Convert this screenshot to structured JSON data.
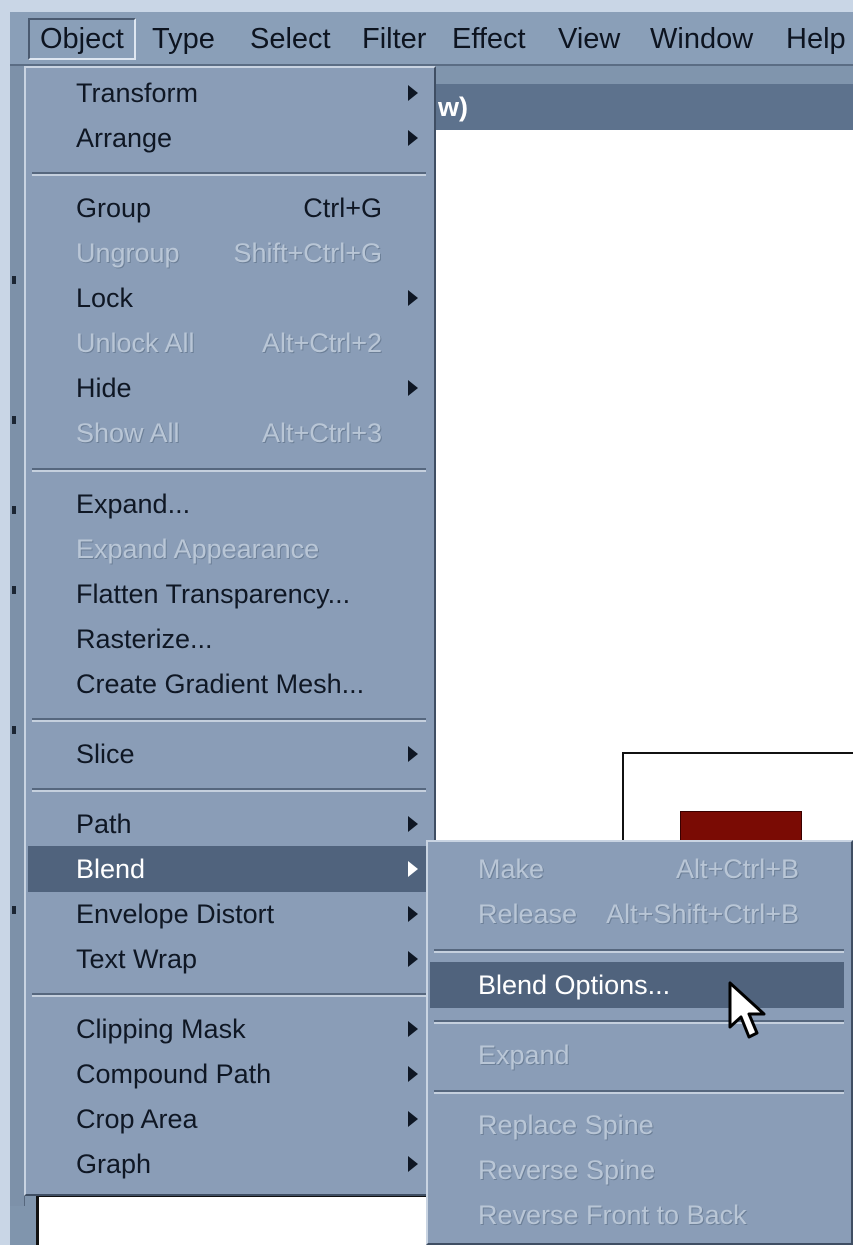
{
  "menubar": {
    "items": [
      "Object",
      "Type",
      "Select",
      "Filter",
      "Effect",
      "View",
      "Window",
      "Help"
    ]
  },
  "document": {
    "title_fragment": "w)"
  },
  "object_menu": {
    "items": [
      {
        "label": "Transform",
        "shortcut": "",
        "submenu": true,
        "disabled": false
      },
      {
        "label": "Arrange",
        "shortcut": "",
        "submenu": true,
        "disabled": false
      },
      {
        "label": "Group",
        "shortcut": "Ctrl+G",
        "submenu": false,
        "disabled": false
      },
      {
        "label": "Ungroup",
        "shortcut": "Shift+Ctrl+G",
        "submenu": false,
        "disabled": true
      },
      {
        "label": "Lock",
        "shortcut": "",
        "submenu": true,
        "disabled": false
      },
      {
        "label": "Unlock All",
        "shortcut": "Alt+Ctrl+2",
        "submenu": false,
        "disabled": true
      },
      {
        "label": "Hide",
        "shortcut": "",
        "submenu": true,
        "disabled": false
      },
      {
        "label": "Show All",
        "shortcut": "Alt+Ctrl+3",
        "submenu": false,
        "disabled": true
      },
      {
        "label": "Expand...",
        "shortcut": "",
        "submenu": false,
        "disabled": false
      },
      {
        "label": "Expand Appearance",
        "shortcut": "",
        "submenu": false,
        "disabled": true
      },
      {
        "label": "Flatten Transparency...",
        "shortcut": "",
        "submenu": false,
        "disabled": false
      },
      {
        "label": "Rasterize...",
        "shortcut": "",
        "submenu": false,
        "disabled": false
      },
      {
        "label": "Create Gradient Mesh...",
        "shortcut": "",
        "submenu": false,
        "disabled": false
      },
      {
        "label": "Slice",
        "shortcut": "",
        "submenu": true,
        "disabled": false
      },
      {
        "label": "Path",
        "shortcut": "",
        "submenu": true,
        "disabled": false
      },
      {
        "label": "Blend",
        "shortcut": "",
        "submenu": true,
        "disabled": false,
        "highlighted": true
      },
      {
        "label": "Envelope Distort",
        "shortcut": "",
        "submenu": true,
        "disabled": false
      },
      {
        "label": "Text Wrap",
        "shortcut": "",
        "submenu": true,
        "disabled": false
      },
      {
        "label": "Clipping Mask",
        "shortcut": "",
        "submenu": true,
        "disabled": false
      },
      {
        "label": "Compound Path",
        "shortcut": "",
        "submenu": true,
        "disabled": false
      },
      {
        "label": "Crop Area",
        "shortcut": "",
        "submenu": true,
        "disabled": false
      },
      {
        "label": "Graph",
        "shortcut": "",
        "submenu": true,
        "disabled": false
      }
    ]
  },
  "blend_menu": {
    "items": [
      {
        "label": "Make",
        "shortcut": "Alt+Ctrl+B",
        "disabled": true
      },
      {
        "label": "Release",
        "shortcut": "Alt+Shift+Ctrl+B",
        "disabled": true
      },
      {
        "label": "Blend Options...",
        "shortcut": "",
        "disabled": false,
        "highlighted": true
      },
      {
        "label": "Expand",
        "shortcut": "",
        "disabled": true
      },
      {
        "label": "Replace Spine",
        "shortcut": "",
        "disabled": true
      },
      {
        "label": "Reverse Spine",
        "shortcut": "",
        "disabled": true
      },
      {
        "label": "Reverse Front to Back",
        "shortcut": "",
        "disabled": true
      }
    ]
  },
  "colors": {
    "menu_bg": "#8a9db7",
    "highlight": "#50637d",
    "disabled_text": "#b9c6d6",
    "artwork_fill": "#7a0b04"
  },
  "cursor": {
    "icon": "arrow-pointer-icon"
  }
}
